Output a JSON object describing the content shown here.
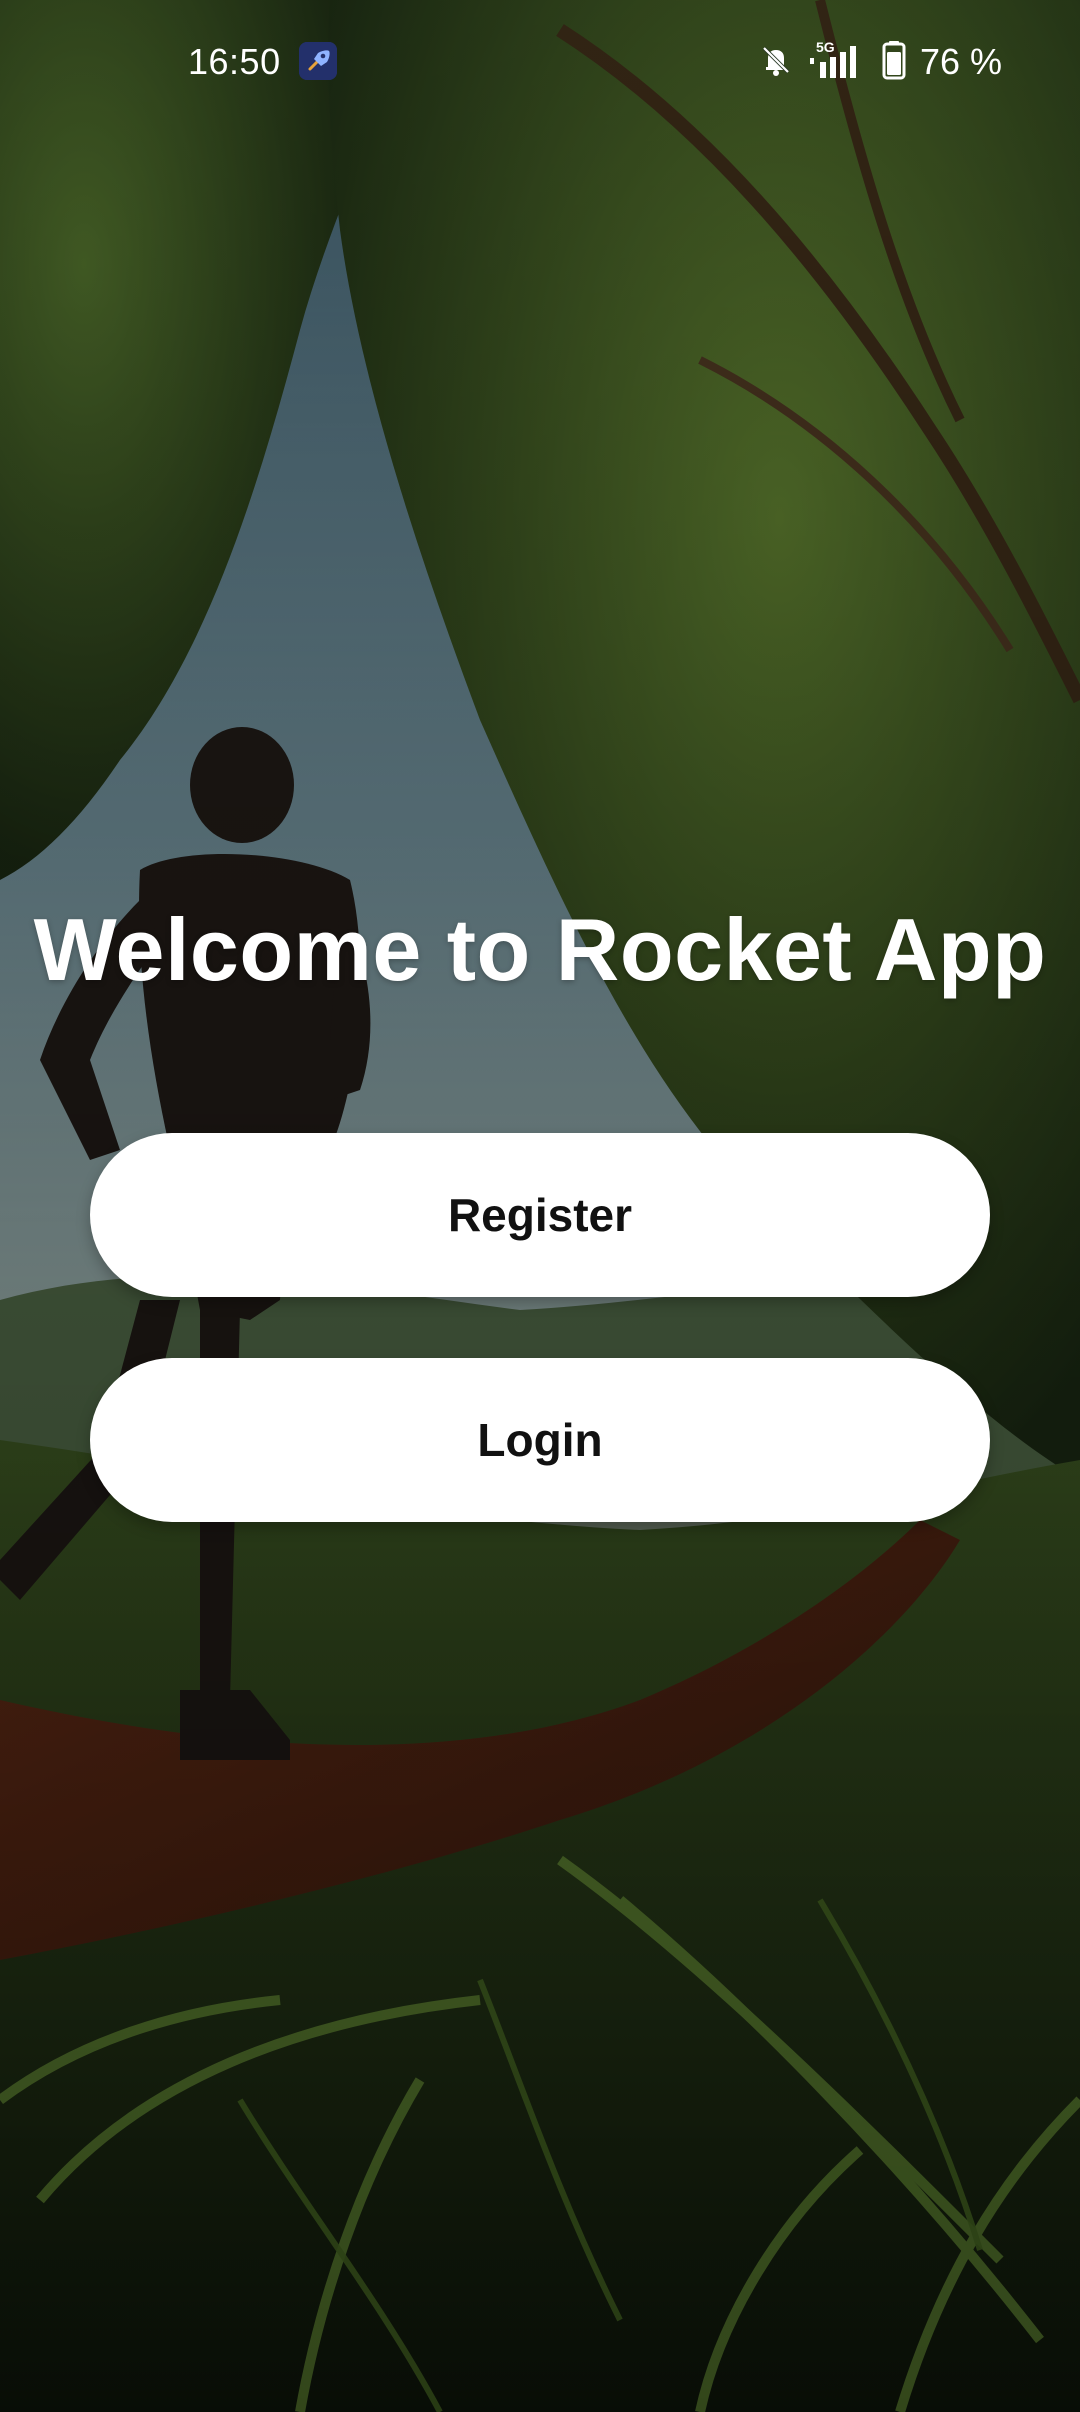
{
  "status_bar": {
    "time": "16:50",
    "battery_percent": "76 %",
    "network_label": "5G",
    "icons": [
      "rocket-app-icon",
      "mute-bell-icon",
      "signal-5g-icon",
      "battery-icon"
    ]
  },
  "welcome": {
    "title": "Welcome to Rocket App"
  },
  "actions": {
    "register_label": "Register",
    "login_label": "Login"
  },
  "colors": {
    "button_bg": "#ffffff",
    "button_text": "#111111",
    "title_text": "#ffffff"
  },
  "background": {
    "icon": "runner-trail-photo"
  }
}
